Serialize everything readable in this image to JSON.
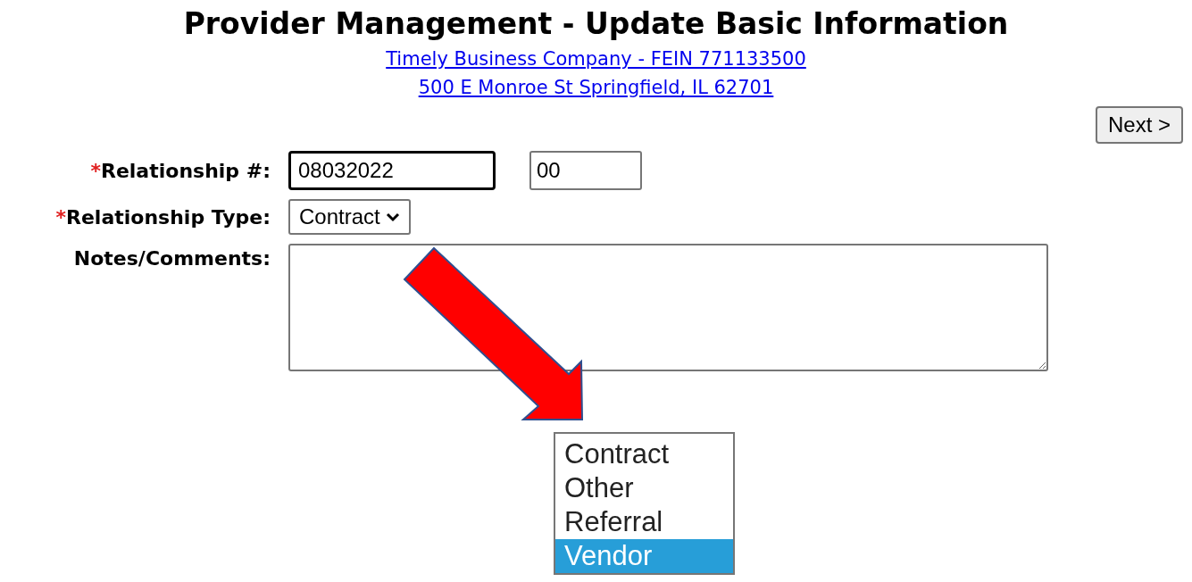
{
  "title": "Provider Management - Update Basic Information",
  "links": [
    "Timely Business Company - FEIN 771133500",
    "500 E Monroe St Springfield, IL 62701"
  ],
  "next_button": "Next >",
  "form": {
    "relationship_number": {
      "required_mark": "*",
      "label": "Relationship #:",
      "value": "08032022",
      "suffix_value": "00",
      "focused": true
    },
    "relationship_type": {
      "required_mark": "*",
      "label": "Relationship Type:",
      "value": "Contract"
    },
    "notes": {
      "label": "Notes/Comments:"
    }
  },
  "dropdown": {
    "options": [
      {
        "label": "Contract",
        "selected": false
      },
      {
        "label": "Other",
        "selected": false
      },
      {
        "label": "Referral",
        "selected": false
      },
      {
        "label": "Vendor",
        "selected": true
      }
    ]
  },
  "annotation": {
    "kind": "arrow"
  }
}
